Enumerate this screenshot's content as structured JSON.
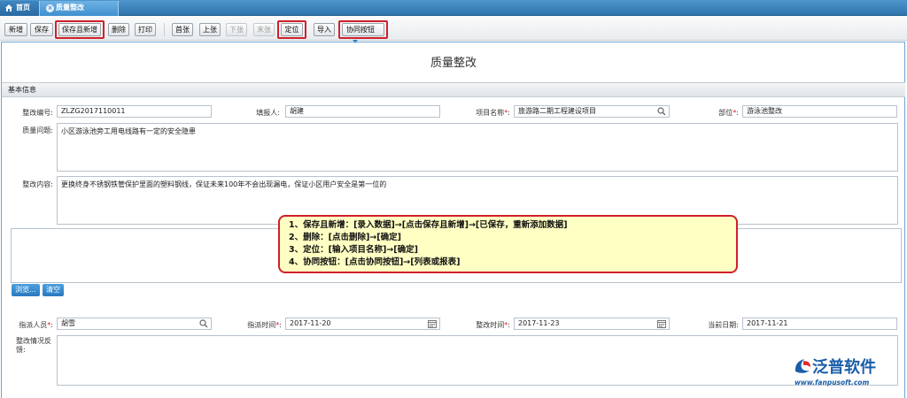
{
  "tabs": [
    {
      "label": "首页"
    },
    {
      "label": "质量整改"
    }
  ],
  "toolbar": {
    "new": "新增",
    "save": "保存",
    "save_and_new": "保存且新增",
    "delete": "删除",
    "print": "打印",
    "first": "首张",
    "prev": "上张",
    "next": "下张",
    "last": "末张",
    "locate": "定位",
    "import": "导入",
    "collab": "协同按钮"
  },
  "page_title": "质量整改",
  "section_basic": "基本信息",
  "form": {
    "rectify_no_label": "整改编号:",
    "rectify_no": "ZLZG2017110011",
    "filler_label": "填报人:",
    "filler": "胡建",
    "project_label": "项目名称",
    "project_label_suffix": ":",
    "project": "旅游路二期工程建设项目",
    "dept_label": "部位",
    "dept_label_suffix": ":",
    "dept": "游泳池整改",
    "quality_issue_label": "质量问题:",
    "quality_issue": "小区游泳池旁工用电线路有一定的安全隐患",
    "rectify_content_label": "整改内容:",
    "rectify_content": "更换终身不锈钢铁管保护里面的塑料钢线，保证未来100年不会出现漏电，保证小区用户安全是第一位的",
    "browse": "浏览...",
    "clear": "清空",
    "assignee_label": "指派人员",
    "assignee_suffix": ":",
    "assignee": "胡雪",
    "assign_time_label": "指派时间",
    "assign_time_suffix": ":",
    "assign_time": "2017-11-20",
    "rectify_time_label": "整改时间",
    "rectify_time_suffix": ":",
    "rectify_time": "2017-11-23",
    "current_date_label": "当前日期:",
    "current_date": "2017-11-21",
    "feedback_label_1": "整改情况反",
    "feedback_label_2": "馈:"
  },
  "required_mark": "*",
  "note_lines": [
    "1、保存且新增：[录入数据]→[点击保存且新增]→[已保存，重新添加数据]",
    "2、删除：[点击删除]→[确定]",
    "3、定位：[输入项目名称]→[确定]",
    "4、协同按钮：[点击协同按钮]→[列表或报表]"
  ],
  "logo": {
    "name": "泛普软件",
    "url": "www.fanpusoft.com"
  },
  "colors": {
    "accent": "#2f73ad",
    "highlight": "#d0202a",
    "note_bg": "#ffffc4"
  }
}
